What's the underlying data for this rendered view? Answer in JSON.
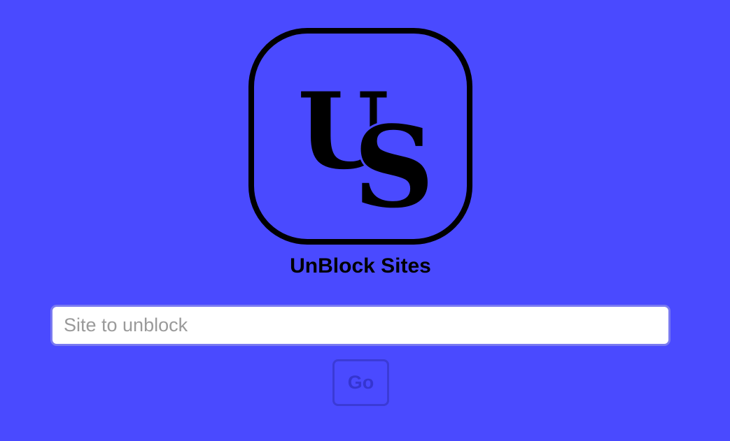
{
  "brand": {
    "logo_text": "US",
    "title": "UnBlock Sites"
  },
  "search": {
    "value": "",
    "placeholder": "Site to unblock"
  },
  "actions": {
    "go_label": "Go"
  },
  "colors": {
    "background": "#4a4aff",
    "input_border": "#7a7af0",
    "go_button": "#3535d0"
  }
}
